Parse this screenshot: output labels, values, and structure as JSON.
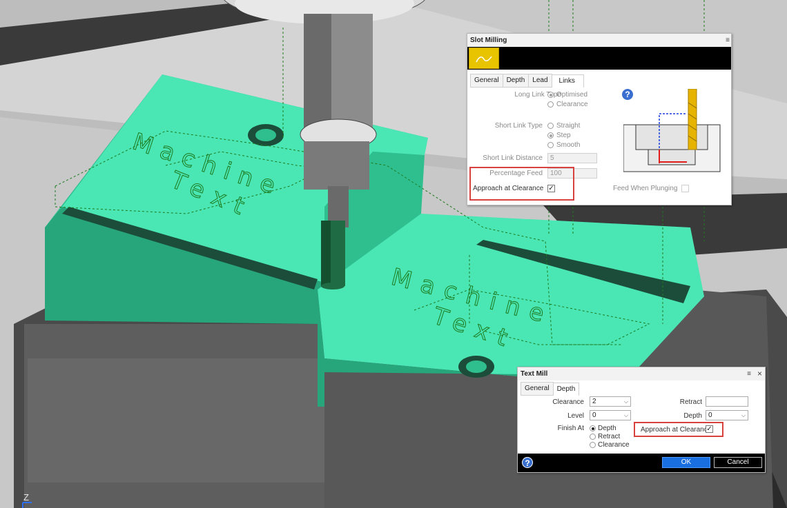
{
  "viewport": {
    "axis_label": "Z",
    "engraving": {
      "word1": "Machine",
      "word2": "Text"
    }
  },
  "slot_milling": {
    "title": "Slot Milling",
    "tabs": [
      "General",
      "Depth",
      "Lead",
      "Links"
    ],
    "active_tab": "Links",
    "long_link_type_label": "Long Link Type",
    "long_link_options": [
      "Optimised",
      "Clearance"
    ],
    "long_link_selected": "Optimised",
    "short_link_type_label": "Short Link Type",
    "short_link_options": [
      "Straight",
      "Step",
      "Smooth"
    ],
    "short_link_selected": "Step",
    "short_link_distance_label": "Short Link Distance",
    "short_link_distance_value": "5",
    "percentage_feed_label": "Percentage Feed",
    "percentage_feed_value": "100",
    "approach_at_clearance_label": "Approach at Clearance",
    "approach_at_clearance_checked": true,
    "feed_when_plunging_label": "Feed When Plunging",
    "feed_when_plunging_checked": false,
    "help_glyph": "?",
    "menu_glyph": "≡"
  },
  "text_mill": {
    "title": "Text Mill",
    "tabs": [
      "General",
      "Depth"
    ],
    "active_tab": "Depth",
    "clearance_label": "Clearance",
    "clearance_value": "2",
    "level_label": "Level",
    "level_value": "0",
    "retract_label": "Retract",
    "retract_value": "",
    "depth_label": "Depth",
    "depth_value": "0",
    "finish_at_label": "Finish At",
    "finish_at_options": [
      "Depth",
      "Retract",
      "Clearance"
    ],
    "finish_at_selected": "Depth",
    "approach_at_clearance_label": "Approach at Clearance",
    "approach_at_clearance_checked": true,
    "ok_label": "OK",
    "cancel_label": "Cancel",
    "help_glyph": "?",
    "menu_glyph": "≡",
    "close_glyph": "×"
  },
  "colors": {
    "highlight": "#d9413f",
    "ok_button": "#1a6fe0",
    "part_green": "#3fe3ae",
    "toolpath_green": "#1d7a1d",
    "strategy_icon": "#e8c400"
  }
}
